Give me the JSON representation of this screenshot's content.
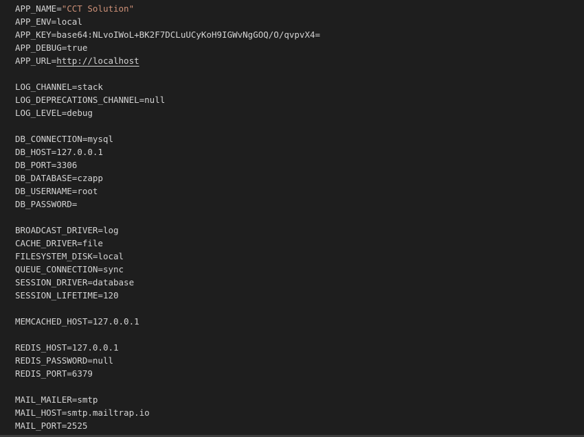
{
  "lines": [
    {
      "key": "APP_NAME=",
      "value": "\"CCT Solution\"",
      "type": "string"
    },
    {
      "key": "APP_ENV=",
      "value": "local",
      "type": "plain"
    },
    {
      "key": "APP_KEY=",
      "value": "base64:NLvoIWoL+BK2F7DCLuUCyKoH9IGWvNgGOQ/O/qvpvX4=",
      "type": "plain"
    },
    {
      "key": "APP_DEBUG=",
      "value": "true",
      "type": "plain"
    },
    {
      "key": "APP_URL=",
      "value": "http://localhost",
      "type": "link"
    },
    null,
    {
      "key": "LOG_CHANNEL=",
      "value": "stack",
      "type": "plain"
    },
    {
      "key": "LOG_DEPRECATIONS_CHANNEL=",
      "value": "null",
      "type": "plain"
    },
    {
      "key": "LOG_LEVEL=",
      "value": "debug",
      "type": "plain"
    },
    null,
    {
      "key": "DB_CONNECTION=",
      "value": "mysql",
      "type": "plain"
    },
    {
      "key": "DB_HOST=",
      "value": "127.0.0.1",
      "type": "plain"
    },
    {
      "key": "DB_PORT=",
      "value": "3306",
      "type": "plain"
    },
    {
      "key": "DB_DATABASE=",
      "value": "czapp",
      "type": "plain"
    },
    {
      "key": "DB_USERNAME=",
      "value": "root",
      "type": "plain"
    },
    {
      "key": "DB_PASSWORD=",
      "value": "",
      "type": "plain"
    },
    null,
    {
      "key": "BROADCAST_DRIVER=",
      "value": "log",
      "type": "plain"
    },
    {
      "key": "CACHE_DRIVER=",
      "value": "file",
      "type": "plain"
    },
    {
      "key": "FILESYSTEM_DISK=",
      "value": "local",
      "type": "plain"
    },
    {
      "key": "QUEUE_CONNECTION=",
      "value": "sync",
      "type": "plain"
    },
    {
      "key": "SESSION_DRIVER=",
      "value": "database",
      "type": "plain"
    },
    {
      "key": "SESSION_LIFETIME=",
      "value": "120",
      "type": "plain"
    },
    null,
    {
      "key": "MEMCACHED_HOST=",
      "value": "127.0.0.1",
      "type": "plain"
    },
    null,
    {
      "key": "REDIS_HOST=",
      "value": "127.0.0.1",
      "type": "plain"
    },
    {
      "key": "REDIS_PASSWORD=",
      "value": "null",
      "type": "plain"
    },
    {
      "key": "REDIS_PORT=",
      "value": "6379",
      "type": "plain"
    },
    null,
    {
      "key": "MAIL_MAILER=",
      "value": "smtp",
      "type": "plain"
    },
    {
      "key": "MAIL_HOST=",
      "value": "smtp.mailtrap.io",
      "type": "plain"
    },
    {
      "key": "MAIL_PORT=",
      "value": "2525",
      "type": "plain"
    }
  ],
  "colors": {
    "background": "#1e1e1e",
    "text": "#d4d4d4",
    "string": "#ce9178"
  }
}
